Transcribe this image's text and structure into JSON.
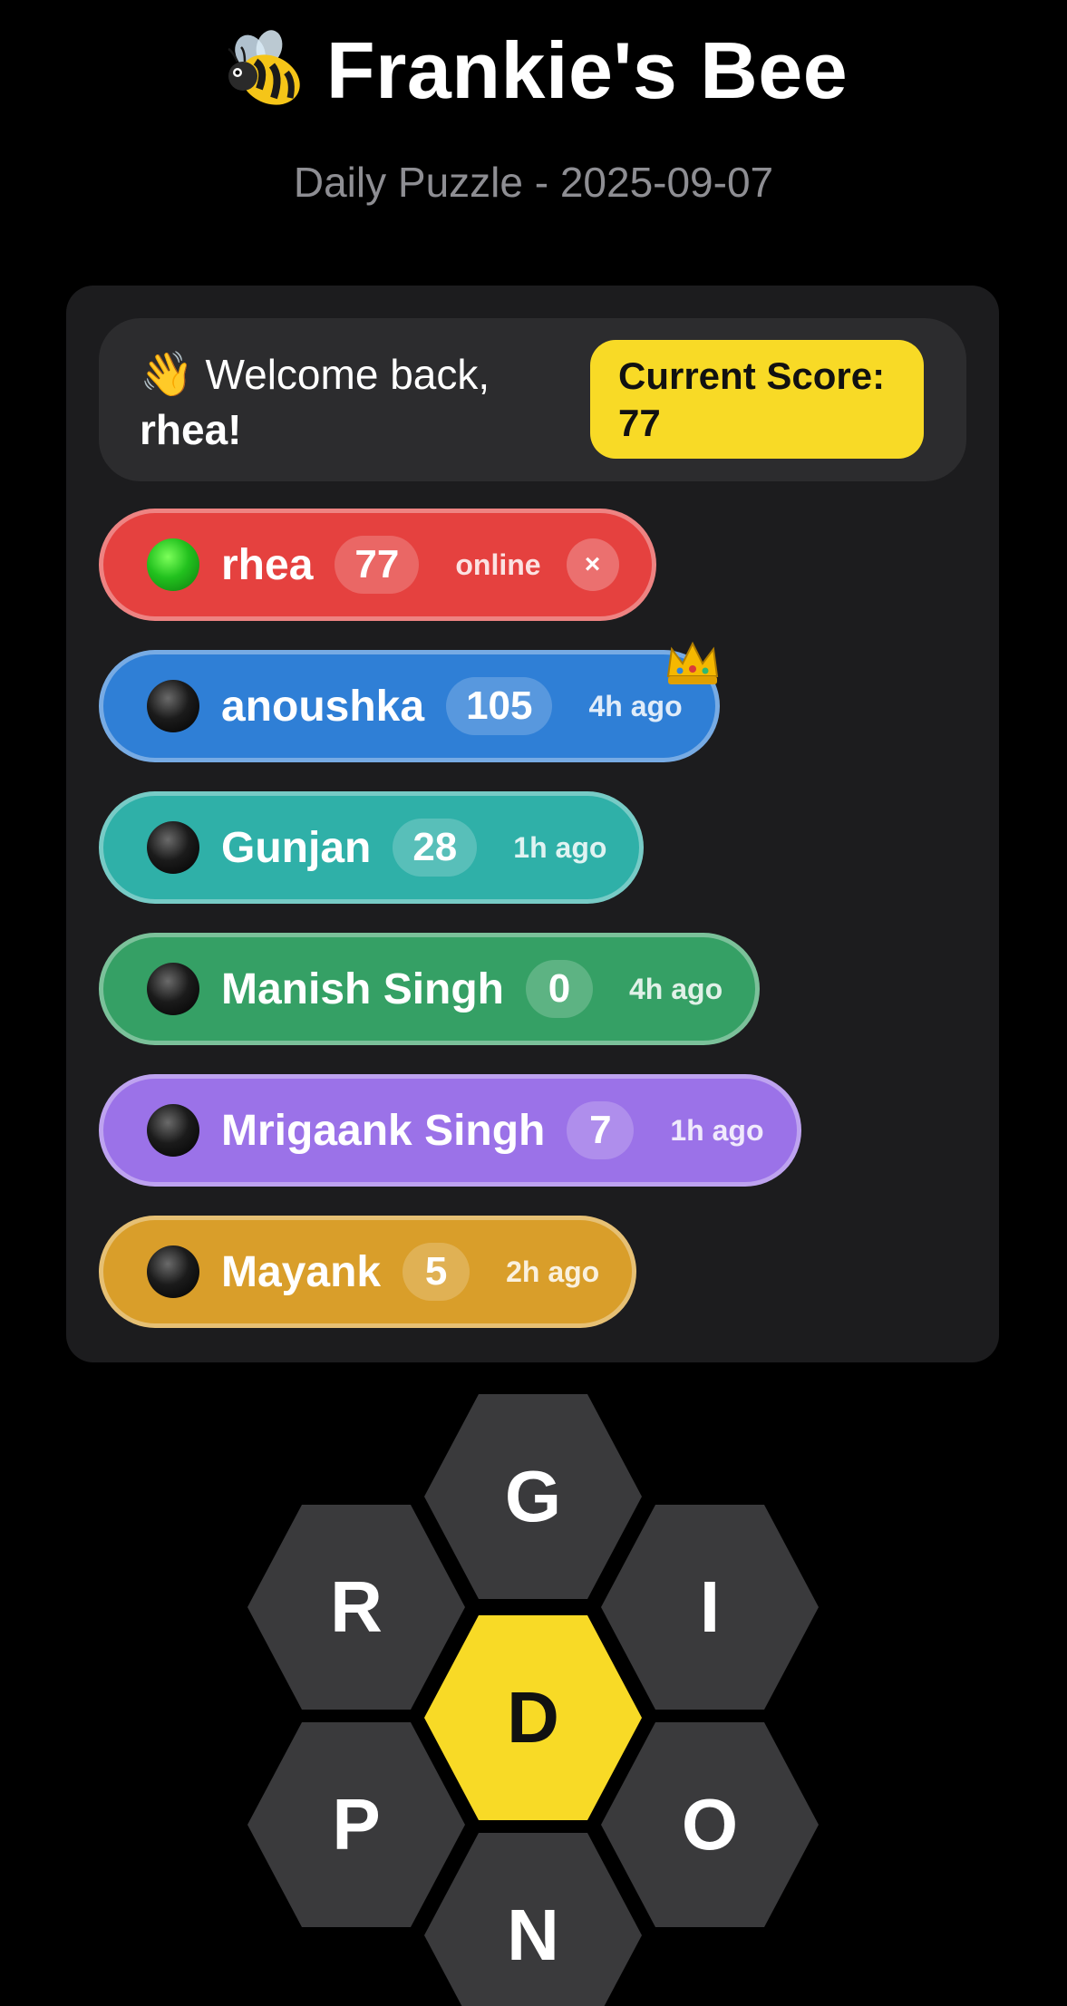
{
  "header": {
    "title": "Frankie's Bee",
    "subtitle": "Daily Puzzle - 2025-09-07"
  },
  "welcome": {
    "greeting": "Welcome back,",
    "username": "rhea!",
    "score_label": "Current Score: 77"
  },
  "players": [
    {
      "name": "rhea",
      "score": "77",
      "status": "online",
      "online": true,
      "color": "#e5413f"
    },
    {
      "name": "anoushka",
      "score": "105",
      "status": "4h ago",
      "online": false,
      "color": "#2f7fd6",
      "leader": true
    },
    {
      "name": "Gunjan",
      "score": "28",
      "status": "1h ago",
      "online": false,
      "color": "#2fb0a8"
    },
    {
      "name": "Manish Singh",
      "score": "0",
      "status": "4h ago",
      "online": false,
      "color": "#35a065"
    },
    {
      "name": "Mrigaank Singh",
      "score": "7",
      "status": "1h ago",
      "online": false,
      "color": "#9b72e8"
    },
    {
      "name": "Mayank",
      "score": "5",
      "status": "2h ago",
      "online": false,
      "color": "#d99e2a"
    }
  ],
  "close_label": "×",
  "letters": {
    "top": "G",
    "upper_left": "R",
    "upper_right": "I",
    "center": "D",
    "lower_left": "P",
    "lower_right": "O",
    "bottom": "N"
  },
  "colors": {
    "accent_yellow": "#f8da26",
    "hex_gray": "#3a3a3c"
  }
}
